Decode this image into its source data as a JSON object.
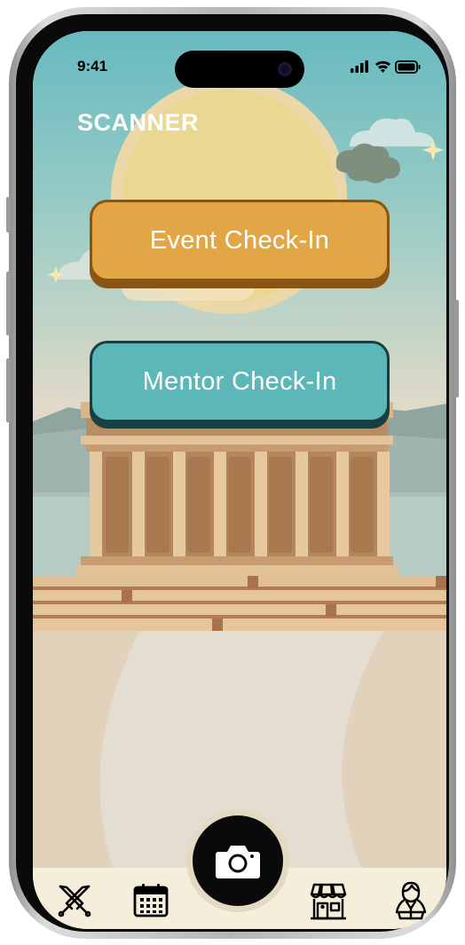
{
  "status_bar": {
    "time": "9:41",
    "icons": [
      "signal-icon",
      "wifi-icon",
      "battery-icon"
    ]
  },
  "page": {
    "title": "SCANNER"
  },
  "buttons": {
    "event_checkin": "Event Check-In",
    "mentor_checkin": "Mentor Check-In"
  },
  "nav": {
    "items": [
      "swords-icon",
      "calendar-icon",
      "camera-icon",
      "shop-icon",
      "profile-icon"
    ]
  },
  "colors": {
    "event_button": "#e2a646",
    "mentor_button": "#5cb7b8",
    "nav_background": "#f5eedb",
    "sky_top": "#6fbcc1",
    "sand": "#e2d2bb"
  }
}
